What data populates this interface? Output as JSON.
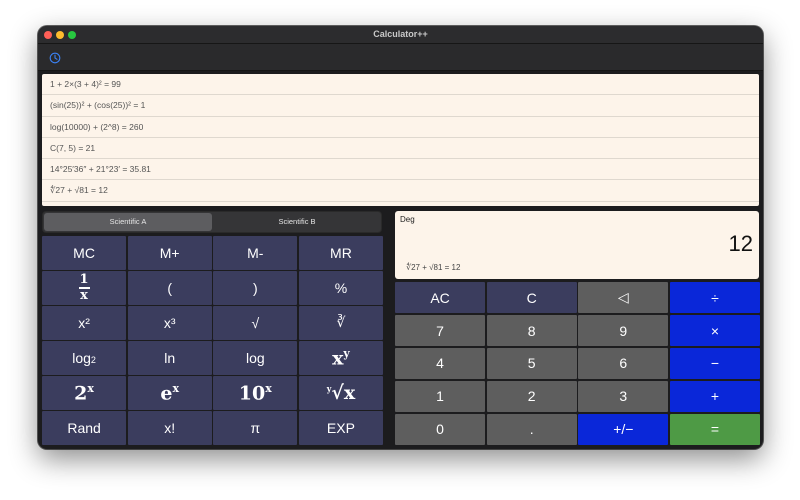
{
  "window": {
    "title": "Calculator++"
  },
  "toolbar": {
    "history_icon": "history-clock-icon"
  },
  "history": [
    "1 + 2×(3 + 4)² = 99",
    "(sin(25))² + (cos(25))² = 1",
    "log(10000) + (2^8) = 260",
    "C(7, 5) = 21",
    "14°25′36″ + 21°23′ = 35.81",
    "∜27 + √81 = 12"
  ],
  "tabs": {
    "a": "Scientific A",
    "b": "Scientific B"
  },
  "display": {
    "mode": "Deg",
    "value": "12",
    "expression": "∜27 + √81 = 12"
  },
  "scientific_keys": {
    "mc": "MC",
    "mplus": "M+",
    "mminus": "M-",
    "mr": "MR",
    "open_paren": "(",
    "close_paren": ")",
    "percent": "%",
    "square": "x²",
    "cube": "x³",
    "sqrt": "√",
    "cbrt": "∛",
    "ln": "ln",
    "log": "log",
    "rand": "Rand",
    "factorial": "x!",
    "pi": "π",
    "exp": "EXP"
  },
  "numpad": {
    "ac": "AC",
    "c": "C",
    "backspace": "◁",
    "divide": "÷",
    "seven": "7",
    "eight": "8",
    "nine": "9",
    "multiply": "×",
    "four": "4",
    "five": "5",
    "six": "6",
    "minus": "−",
    "one": "1",
    "two": "2",
    "three": "3",
    "plus": "+",
    "zero": "0",
    "dot": ".",
    "sign": "+/−",
    "equals": "="
  },
  "colors": {
    "function_key": "#3b3d5e",
    "number_key": "#5e5e5e",
    "operator_key": "#0a27d9",
    "equals_key": "#4e9a45",
    "display_bg": "#fdf4ea"
  }
}
